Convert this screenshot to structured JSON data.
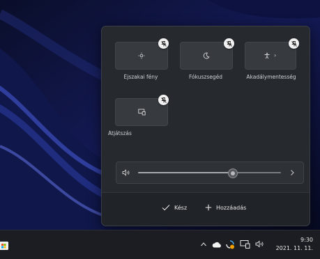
{
  "quick_settings": {
    "tiles": [
      {
        "label": "Éjszakai fény",
        "icon": "brightness-icon"
      },
      {
        "label": "Fókuszsegéd",
        "icon": "moon-icon"
      },
      {
        "label": "Akadálymentesség",
        "icon": "accessibility-icon"
      },
      {
        "label": "Átjátszás",
        "icon": "cast-icon"
      }
    ],
    "unpin_icon": "unpin-icon",
    "volume": {
      "level": 0.66,
      "icon": "speaker-icon"
    },
    "footer": {
      "done_label": "Kész",
      "add_label": "Hozzáadás"
    }
  },
  "taskbar": {
    "time": "9:30",
    "date": "2021. 11. 11."
  },
  "colors": {
    "panel": "#262a2f",
    "tile": "#373b40",
    "taskbar": "#1c1d22"
  }
}
